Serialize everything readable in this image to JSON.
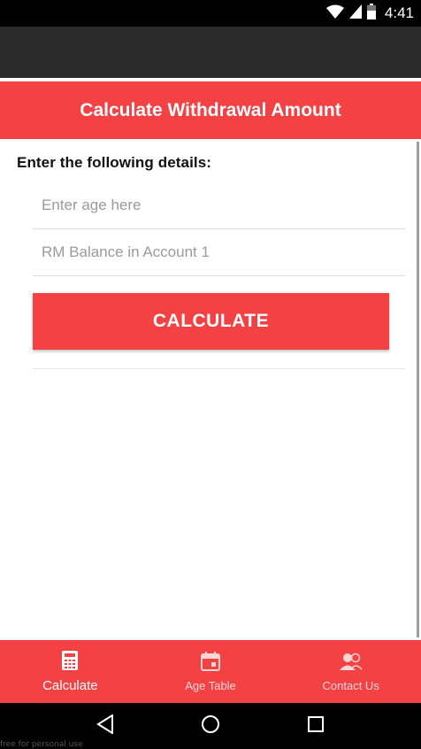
{
  "status_bar": {
    "time": "4:41",
    "icons": [
      "wifi-icon",
      "signal-icon",
      "battery-icon"
    ]
  },
  "header": {
    "title": "Calculate Withdrawal Amount"
  },
  "form": {
    "instructions": "Enter the following details:",
    "age": {
      "placeholder": "Enter age here",
      "value": ""
    },
    "balance": {
      "placeholder": "RM Balance in Account 1",
      "value": ""
    },
    "calculate_label": "CALCULATE"
  },
  "bottom_nav": {
    "items": [
      {
        "label": "Calculate",
        "icon": "calculator-icon",
        "active": true
      },
      {
        "label": "Age Table",
        "icon": "calendar-icon",
        "active": false
      },
      {
        "label": "Contact Us",
        "icon": "contacts-icon",
        "active": false
      }
    ]
  },
  "system_nav": {
    "icons": [
      "back-icon",
      "home-icon",
      "recents-icon"
    ]
  },
  "watermark": "free for personal use",
  "colors": {
    "accent": "#f44144",
    "action_bar": "#2b2b2b"
  }
}
